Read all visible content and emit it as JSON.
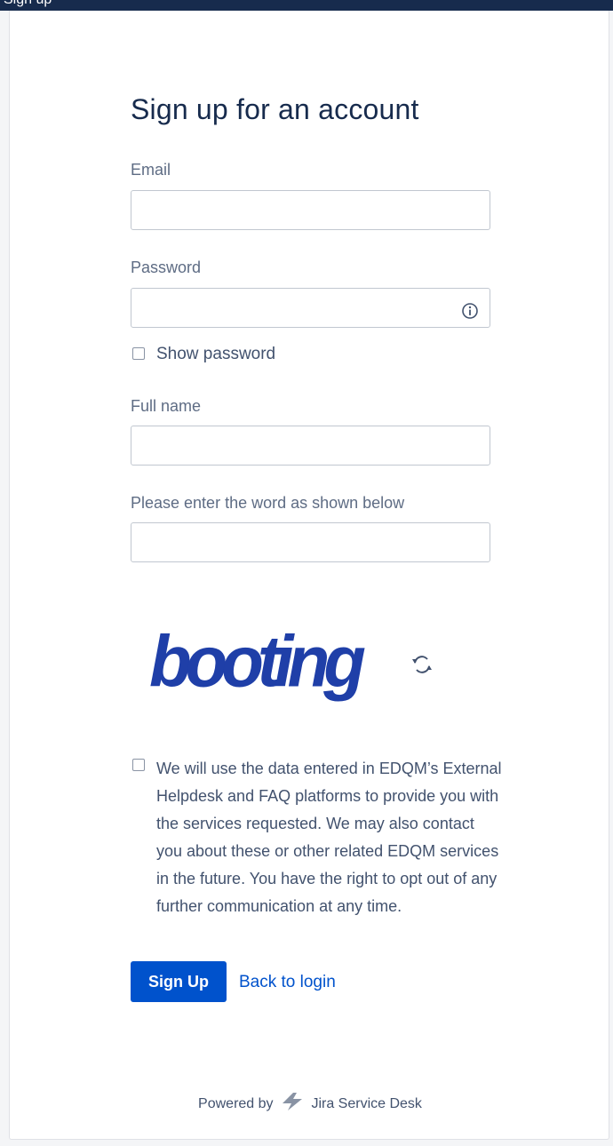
{
  "top_bar": {
    "title": "Sign up"
  },
  "form": {
    "heading": "Sign up for an account",
    "email_label": "Email",
    "email_value": "",
    "password_label": "Password",
    "password_value": "",
    "show_password_label": "Show password",
    "fullname_label": "Full name",
    "fullname_value": "",
    "captcha_label": "Please enter the word as shown below",
    "captcha_value": "",
    "captcha_word": "booting",
    "consent_text": "We will use the data entered in EDQM’s External Helpdesk and FAQ platforms to provide you with the services requested. We may also contact you about these or other related EDQM services in the future. You have the right to opt out of any further communication at any time.",
    "submit_label": "Sign Up",
    "back_link": "Back to login"
  },
  "footer": {
    "powered_by": "Powered by",
    "product": "Jira Service Desk"
  },
  "icons": {
    "info": "info-icon",
    "refresh": "refresh-icon",
    "logo": "jira-bolt-icon"
  },
  "colors": {
    "primary": "#0052cc",
    "captcha": "#1f3fa8",
    "heading": "#172b4d",
    "topbar": "#172b4d"
  }
}
